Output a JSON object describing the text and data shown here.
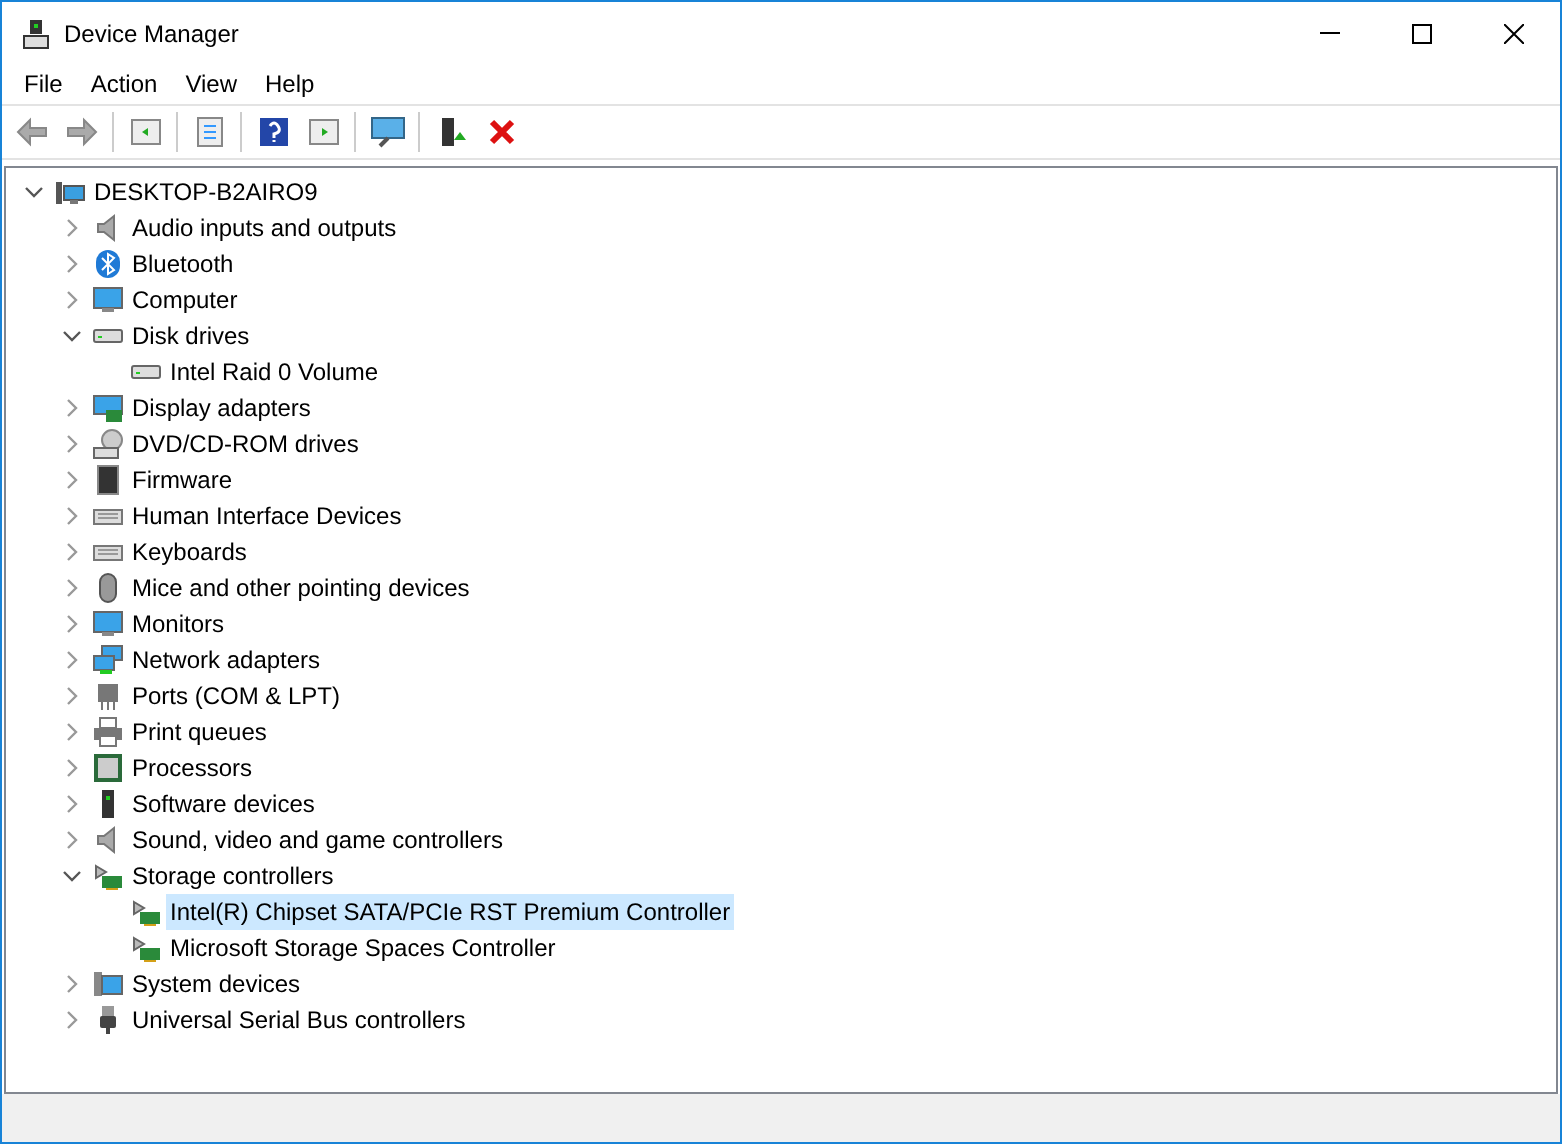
{
  "window": {
    "title": "Device Manager"
  },
  "menu": [
    "File",
    "Action",
    "View",
    "Help"
  ],
  "tree": {
    "label": "DESKTOP-B2AIRO9",
    "expanded": true,
    "selected": false,
    "children": [
      {
        "label": "Audio inputs and outputs",
        "expanded": false,
        "selected": false
      },
      {
        "label": "Bluetooth",
        "expanded": false,
        "selected": false
      },
      {
        "label": "Computer",
        "expanded": false,
        "selected": false
      },
      {
        "label": "Disk drives",
        "expanded": true,
        "selected": false,
        "children": [
          {
            "label": "Intel Raid 0 Volume",
            "selected": false
          }
        ]
      },
      {
        "label": "Display adapters",
        "expanded": false,
        "selected": false
      },
      {
        "label": "DVD/CD-ROM drives",
        "expanded": false,
        "selected": false
      },
      {
        "label": "Firmware",
        "expanded": false,
        "selected": false
      },
      {
        "label": "Human Interface Devices",
        "expanded": false,
        "selected": false
      },
      {
        "label": "Keyboards",
        "expanded": false,
        "selected": false
      },
      {
        "label": "Mice and other pointing devices",
        "expanded": false,
        "selected": false
      },
      {
        "label": "Monitors",
        "expanded": false,
        "selected": false
      },
      {
        "label": "Network adapters",
        "expanded": false,
        "selected": false
      },
      {
        "label": "Ports (COM & LPT)",
        "expanded": false,
        "selected": false
      },
      {
        "label": "Print queues",
        "expanded": false,
        "selected": false
      },
      {
        "label": "Processors",
        "expanded": false,
        "selected": false
      },
      {
        "label": "Software devices",
        "expanded": false,
        "selected": false
      },
      {
        "label": "Sound, video and game controllers",
        "expanded": false,
        "selected": false
      },
      {
        "label": "Storage controllers",
        "expanded": true,
        "selected": false,
        "children": [
          {
            "label": "Intel(R) Chipset SATA/PCIe RST Premium Controller",
            "selected": true
          },
          {
            "label": "Microsoft Storage Spaces Controller",
            "selected": false
          }
        ]
      },
      {
        "label": "System devices",
        "expanded": false,
        "selected": false
      },
      {
        "label": "Universal Serial Bus controllers",
        "expanded": false,
        "selected": false
      }
    ]
  }
}
